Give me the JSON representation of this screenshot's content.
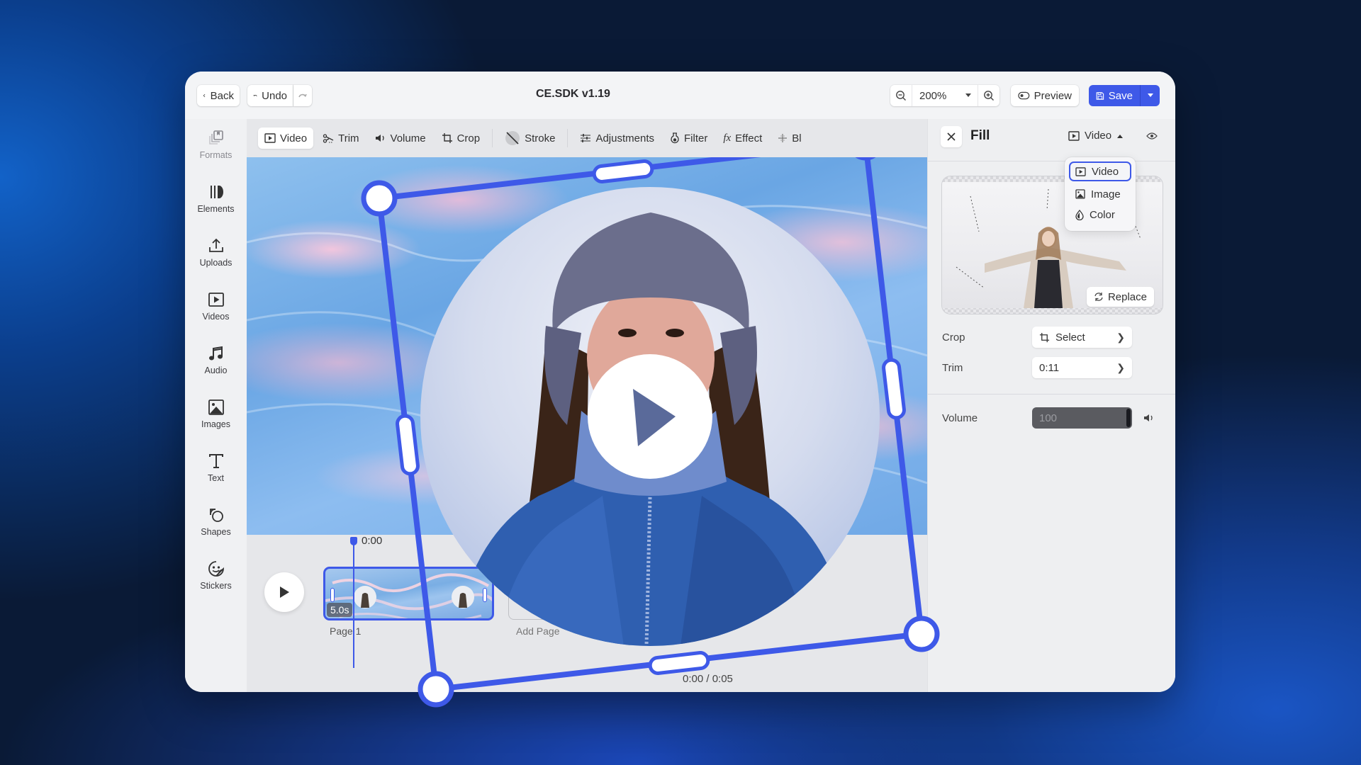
{
  "header": {
    "back_label": "Back",
    "undo_label": "Undo",
    "title": "CE.SDK v1.19",
    "zoom_value": "200%",
    "preview_label": "Preview",
    "save_label": "Save"
  },
  "sidebar": {
    "items": [
      {
        "label": "Formats",
        "icon": "formats-icon"
      },
      {
        "label": "Elements",
        "icon": "elements-icon"
      },
      {
        "label": "Uploads",
        "icon": "upload-icon"
      },
      {
        "label": "Videos",
        "icon": "video-icon"
      },
      {
        "label": "Audio",
        "icon": "music-note-icon"
      },
      {
        "label": "Images",
        "icon": "image-icon"
      },
      {
        "label": "Text",
        "icon": "text-icon"
      },
      {
        "label": "Shapes",
        "icon": "shapes-icon"
      },
      {
        "label": "Stickers",
        "icon": "sticker-icon"
      }
    ]
  },
  "toolbar": {
    "items": [
      {
        "label": "Video",
        "icon": "video-icon",
        "active": true
      },
      {
        "label": "Trim",
        "icon": "scissors-icon"
      },
      {
        "label": "Volume",
        "icon": "speaker-icon"
      },
      {
        "label": "Crop",
        "icon": "crop-icon"
      },
      {
        "label": "Stroke",
        "icon": "stroke-none-icon"
      },
      {
        "label": "Adjustments",
        "icon": "sliders-icon"
      },
      {
        "label": "Filter",
        "icon": "flask-icon"
      },
      {
        "label": "Effect",
        "icon": "fx-icon"
      },
      {
        "label": "Bl",
        "icon": "blur-icon"
      }
    ]
  },
  "timeline": {
    "playhead_time": "0:00",
    "clip_duration": "5.0s",
    "page_label": "Page 1",
    "add_page_label": "Add Page",
    "time_readout": "0:00 / 0:05"
  },
  "panel": {
    "title": "Fill",
    "fill_type": "Video",
    "dropdown_options": [
      "Video",
      "Image",
      "Color"
    ],
    "dropdown_selected": "Video",
    "replace_label": "Replace",
    "crop_label": "Crop",
    "crop_value": "Select",
    "trim_label": "Trim",
    "trim_value": "0:11",
    "volume_label": "Volume",
    "volume_value": "100"
  },
  "colors": {
    "accent": "#3e59e8",
    "selection": "#4a5ef5"
  }
}
